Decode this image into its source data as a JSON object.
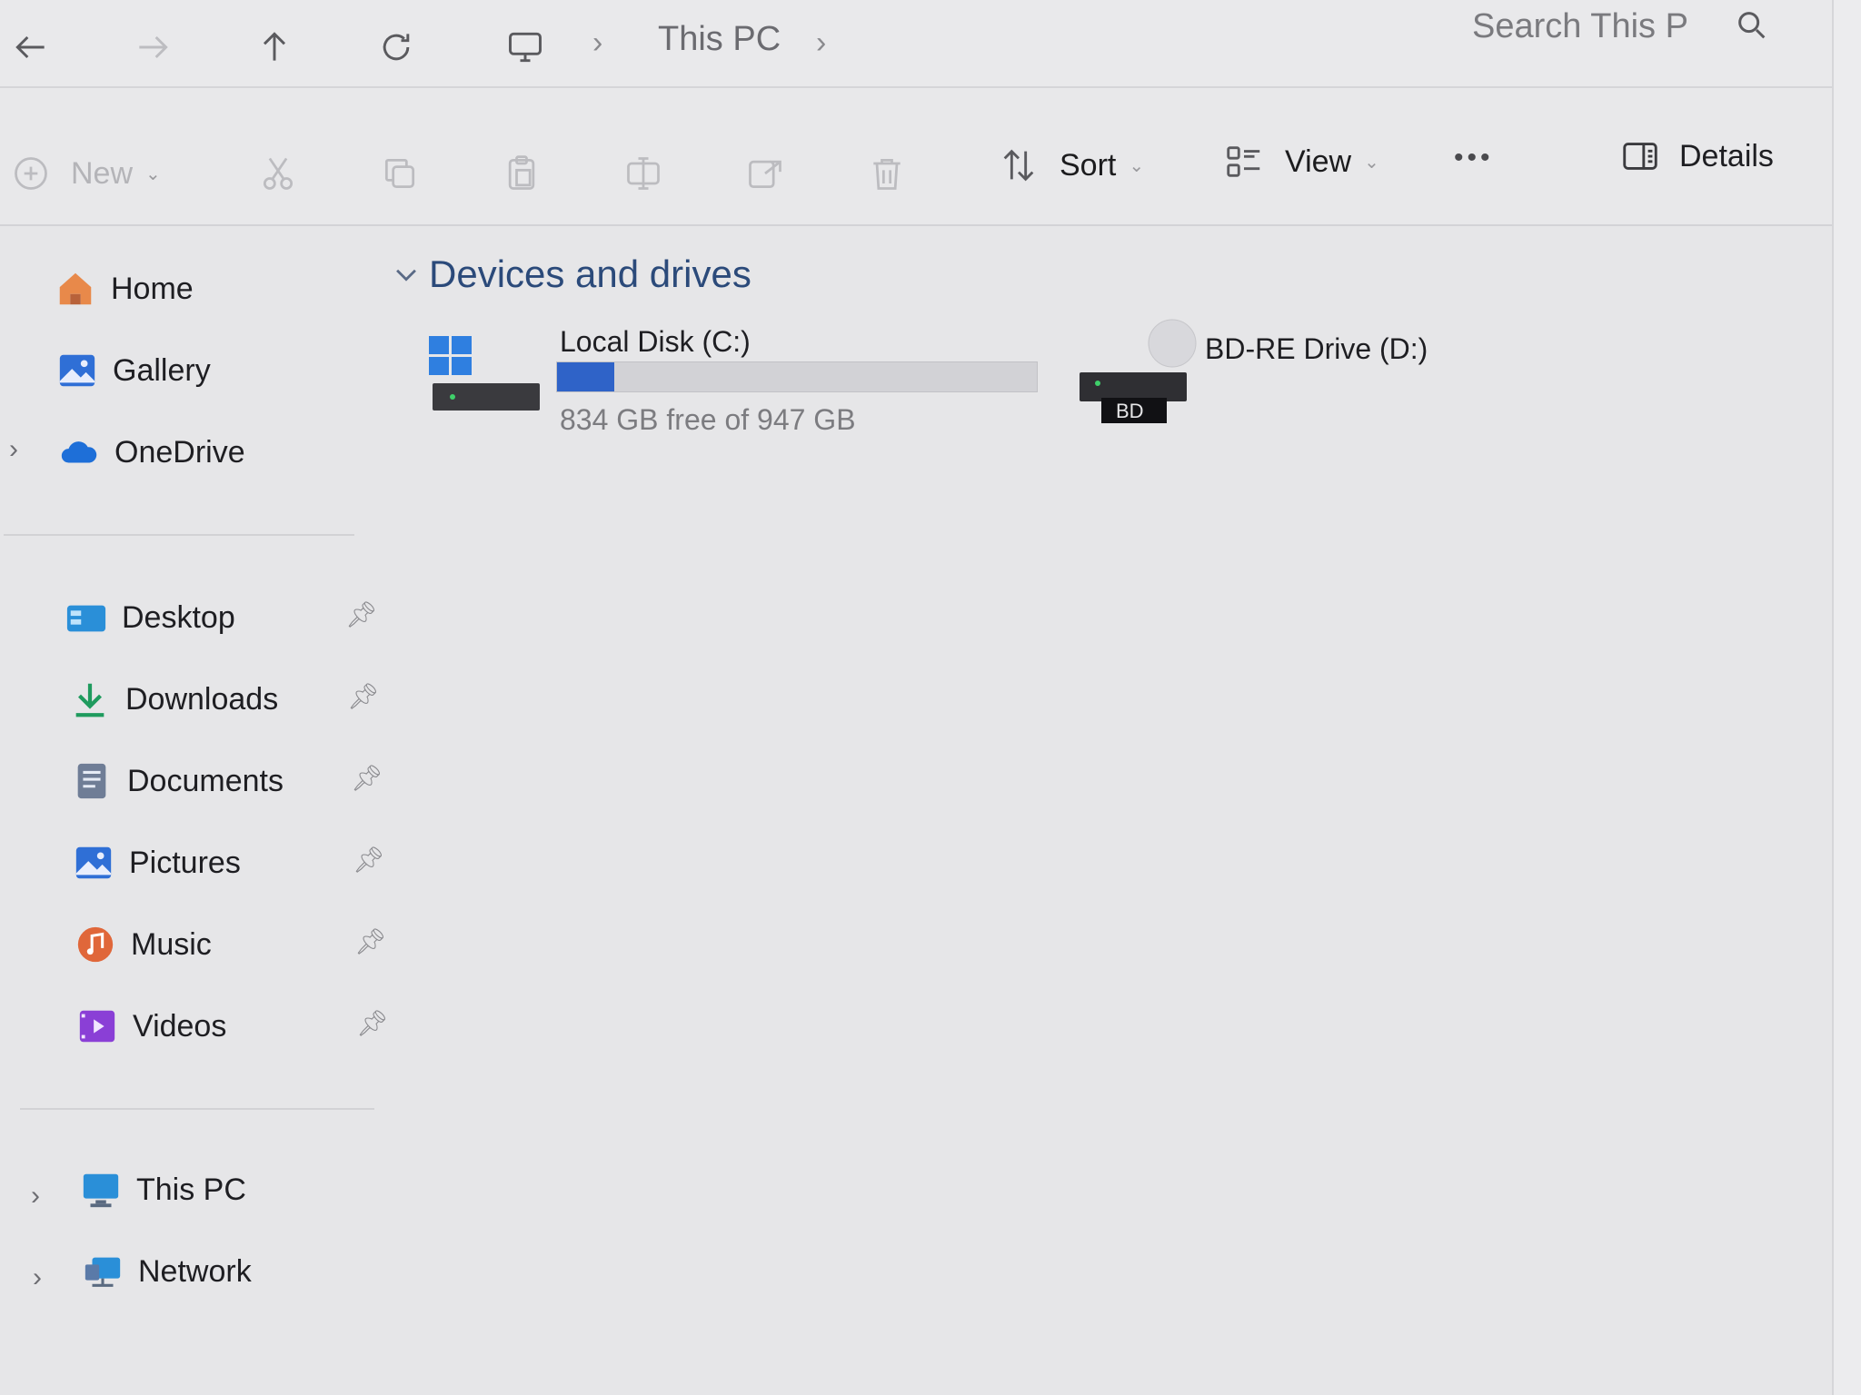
{
  "addressbar": {
    "breadcrumb": [
      "This PC"
    ],
    "search_placeholder": "Search This P"
  },
  "toolbar": {
    "new_label": "New",
    "sort_label": "Sort",
    "view_label": "View",
    "more_label": "•••",
    "details_label": "Details"
  },
  "sidebar": {
    "top_items": [
      {
        "label": "Home",
        "icon": "home-icon"
      },
      {
        "label": "Gallery",
        "icon": "gallery-icon"
      },
      {
        "label": "OneDrive",
        "icon": "onedrive-icon"
      }
    ],
    "quick_access": [
      {
        "label": "Desktop",
        "icon": "desktop-folder-icon"
      },
      {
        "label": "Downloads",
        "icon": "downloads-icon"
      },
      {
        "label": "Documents",
        "icon": "documents-icon"
      },
      {
        "label": "Pictures",
        "icon": "pictures-icon"
      },
      {
        "label": "Music",
        "icon": "music-icon"
      },
      {
        "label": "Videos",
        "icon": "videos-icon"
      }
    ],
    "bottom_items": [
      {
        "label": "This PC",
        "icon": "this-pc-icon"
      },
      {
        "label": "Network",
        "icon": "network-icon"
      }
    ]
  },
  "content": {
    "section_title": "Devices and drives",
    "drives": [
      {
        "name": "Local Disk (C:)",
        "free_text": "834 GB free of 947 GB",
        "used_fraction": 0.12
      },
      {
        "name": "BD-RE Drive (D:)",
        "badge": "BD"
      }
    ]
  },
  "colors": {
    "accent": "#2f63c8",
    "section_heading": "#2b4a7a",
    "background": "#e6e6e8"
  }
}
